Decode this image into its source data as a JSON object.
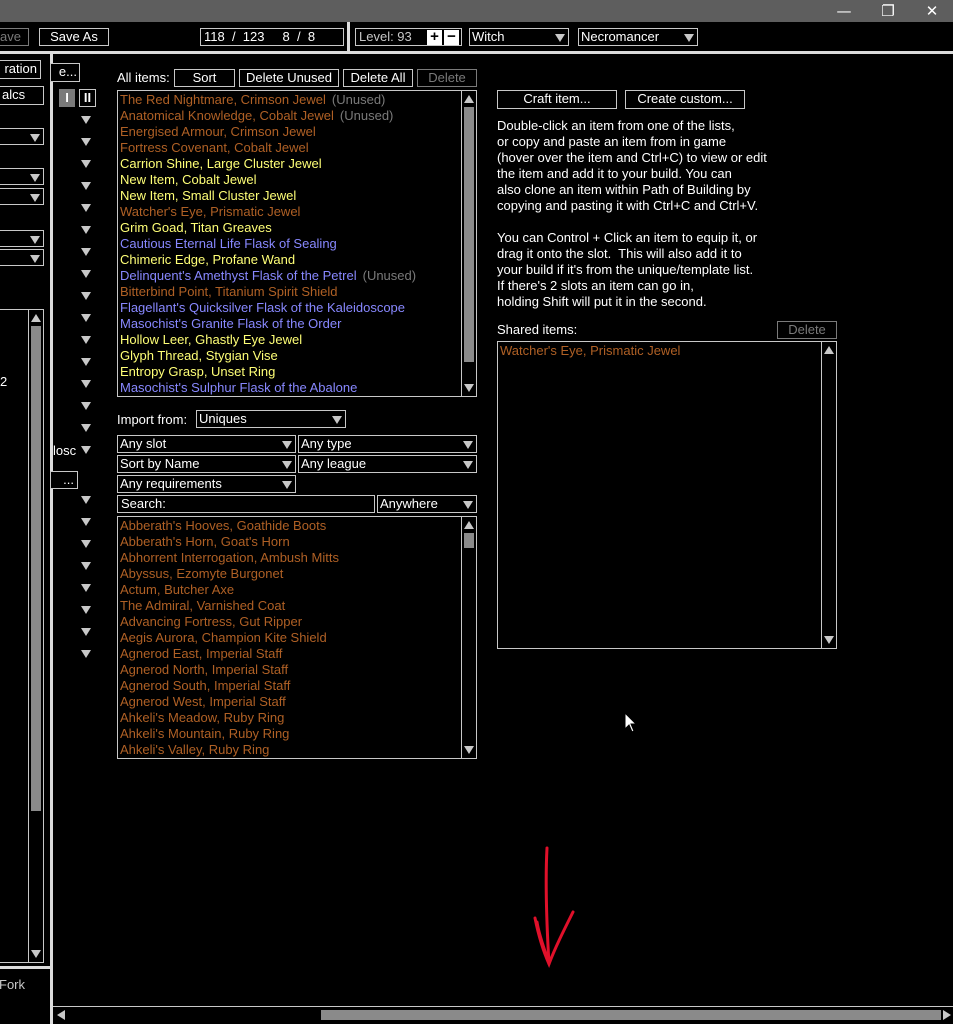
{
  "window": {
    "minimize_glyph": "—",
    "restore_glyph": "❐",
    "close_glyph": "✕"
  },
  "toolbar": {
    "save_label": "ave",
    "save_as_label": "Save As",
    "points_display": "118  /  123     8  /  8",
    "level_label": "Level: 93",
    "class_value": "Witch",
    "ascendancy_value": "Necromancer"
  },
  "left": {
    "tab_fragment": "ration",
    "calcs_fragment": "alcs",
    "field_fragment": "e...",
    "dots_fragment": "...",
    "number_fragment": "2",
    "blue_fragment": "losc",
    "fork_label": "Fork",
    "set_one": "I",
    "set_two": "II"
  },
  "items": {
    "all_items_label": "All items:",
    "sort_label": "Sort",
    "delete_unused_label": "Delete Unused",
    "delete_all_label": "Delete All",
    "delete_label": "Delete",
    "list": [
      {
        "name": "The Red Nightmare, Crimson Jewel",
        "rarity": "unique",
        "unused": "(Unused)"
      },
      {
        "name": "Anatomical Knowledge, Cobalt Jewel",
        "rarity": "unique",
        "unused": "(Unused)"
      },
      {
        "name": "Energised Armour, Crimson Jewel",
        "rarity": "unique",
        "unused": ""
      },
      {
        "name": "Fortress Covenant, Cobalt Jewel",
        "rarity": "unique",
        "unused": ""
      },
      {
        "name": "Carrion Shine, Large Cluster Jewel",
        "rarity": "rare",
        "unused": ""
      },
      {
        "name": "New Item, Cobalt Jewel",
        "rarity": "rare",
        "unused": ""
      },
      {
        "name": "New Item, Small Cluster Jewel",
        "rarity": "rare",
        "unused": ""
      },
      {
        "name": "Watcher's Eye, Prismatic Jewel",
        "rarity": "unique",
        "unused": ""
      },
      {
        "name": "Grim Goad, Titan Greaves",
        "rarity": "rare",
        "unused": ""
      },
      {
        "name": "Cautious Eternal Life Flask of Sealing",
        "rarity": "magic",
        "unused": ""
      },
      {
        "name": "Chimeric Edge, Profane Wand",
        "rarity": "rare",
        "unused": ""
      },
      {
        "name": "Delinquent's Amethyst Flask of the Petrel",
        "rarity": "magic",
        "unused": "(Unused)"
      },
      {
        "name": "Bitterbind Point, Titanium Spirit Shield",
        "rarity": "unique",
        "unused": ""
      },
      {
        "name": "Flagellant's Quicksilver Flask of the Kaleidoscope",
        "rarity": "magic",
        "unused": ""
      },
      {
        "name": "Masochist's Granite Flask of the Order",
        "rarity": "magic",
        "unused": ""
      },
      {
        "name": "Hollow Leer, Ghastly Eye Jewel",
        "rarity": "rare",
        "unused": ""
      },
      {
        "name": "Glyph Thread, Stygian Vise",
        "rarity": "rare",
        "unused": ""
      },
      {
        "name": "Entropy Grasp, Unset Ring",
        "rarity": "rare",
        "unused": ""
      },
      {
        "name": "Masochist's Sulphur Flask of the Abalone",
        "rarity": "magic",
        "unused": ""
      }
    ]
  },
  "import": {
    "label": "Import from:",
    "source_value": "Uniques",
    "slot_value": "Any slot",
    "type_value": "Any type",
    "sort_value": "Sort by Name",
    "league_value": "Any league",
    "requirements_value": "Any requirements",
    "search_label": "Search:",
    "search_mode_value": "Anywhere",
    "uniques": [
      "Abberath's Hooves, Goathide Boots",
      "Abberath's Horn, Goat's Horn",
      "Abhorrent Interrogation, Ambush Mitts",
      "Abyssus, Ezomyte Burgonet",
      "Actum, Butcher Axe",
      "The Admiral, Varnished Coat",
      "Advancing Fortress, Gut Ripper",
      "Aegis Aurora, Champion Kite Shield",
      "Agnerod East, Imperial Staff",
      "Agnerod North, Imperial Staff",
      "Agnerod South, Imperial Staff",
      "Agnerod West, Imperial Staff",
      "Ahkeli's Meadow, Ruby Ring",
      "Ahkeli's Mountain, Ruby Ring",
      "Ahkeli's Valley, Ruby Ring"
    ]
  },
  "right": {
    "craft_label": "Craft item...",
    "create_custom_label": "Create custom...",
    "info_text": "Double-click an item from one of the lists,\nor copy and paste an item from in game\n(hover over the item and Ctrl+C) to view or edit\nthe item and add it to your build. You can\nalso clone an item within Path of Building by\ncopying and pasting it with Ctrl+C and Ctrl+V.\n\nYou can Control + Click an item to equip it, or\ndrag it onto the slot.  This will also add it to\nyour build if it's from the unique/template list.\nIf there's 2 slots an item can go in,\nholding Shift will put it in the second.",
    "shared_label": "Shared items:",
    "shared_delete_label": "Delete",
    "shared_items": [
      "Watcher's Eye, Prismatic Jewel"
    ]
  },
  "colors": {
    "unique": "#af6025",
    "rare": "#ffff77",
    "magic": "#8888ff",
    "unused": "#7a7a7a",
    "annotation_arrow": "#e0102a"
  }
}
